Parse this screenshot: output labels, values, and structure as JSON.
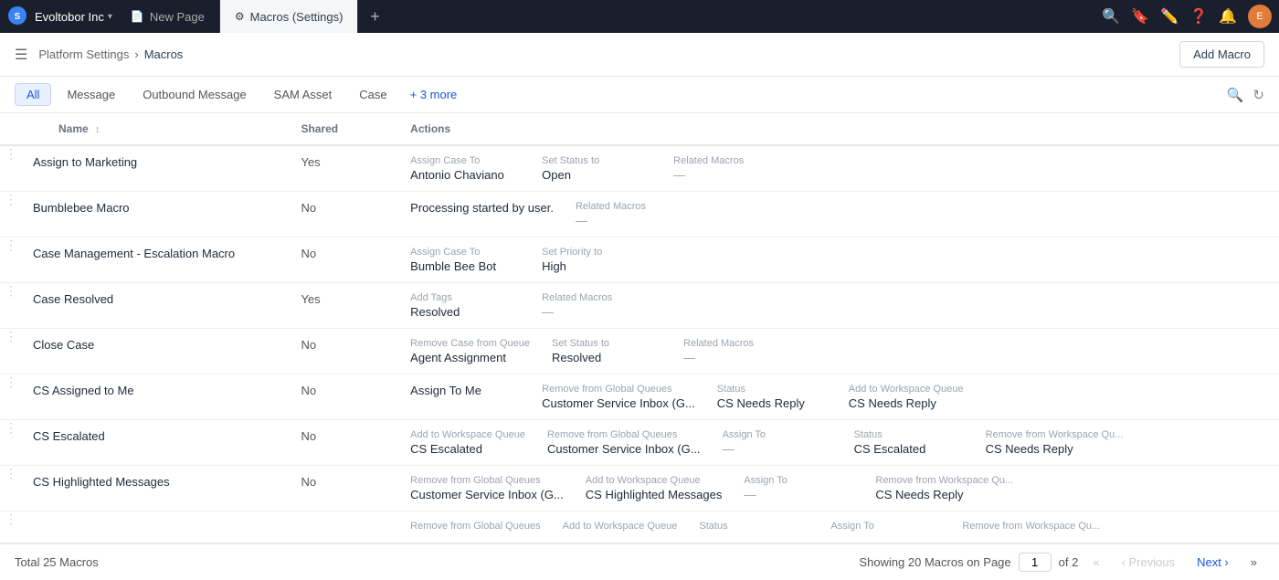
{
  "topNav": {
    "appName": "Evoltobor Inc",
    "chevron": "▾",
    "tabs": [
      {
        "id": "new-page",
        "label": "New Page",
        "icon": "📄",
        "active": false
      },
      {
        "id": "macros-settings",
        "label": "Macros (Settings)",
        "icon": "⚙",
        "active": true
      }
    ],
    "addTabIcon": "+",
    "actions": [
      {
        "id": "search",
        "icon": "🔍"
      },
      {
        "id": "bookmark",
        "icon": "🔖"
      },
      {
        "id": "edit",
        "icon": "✏️"
      },
      {
        "id": "help",
        "icon": "❓"
      },
      {
        "id": "bell",
        "icon": "🔔"
      }
    ],
    "avatar": "E"
  },
  "subHeader": {
    "platformSettings": "Platform Settings",
    "separator": "›",
    "current": "Macros",
    "addMacroLabel": "Add Macro"
  },
  "filterBar": {
    "tabs": [
      {
        "id": "all",
        "label": "All",
        "active": true
      },
      {
        "id": "message",
        "label": "Message",
        "active": false
      },
      {
        "id": "outbound-message",
        "label": "Outbound Message",
        "active": false
      },
      {
        "id": "sam-asset",
        "label": "SAM Asset",
        "active": false
      },
      {
        "id": "case",
        "label": "Case",
        "active": false
      }
    ],
    "moreLabel": "+ 3 more"
  },
  "table": {
    "headers": [
      {
        "id": "name",
        "label": "Name"
      },
      {
        "id": "shared",
        "label": "Shared"
      },
      {
        "id": "actions",
        "label": "Actions"
      }
    ],
    "rows": [
      {
        "id": "assign-to-marketing",
        "name": "Assign to Marketing",
        "shared": "Yes",
        "actions": [
          {
            "label": "Assign Case To",
            "value": "Antonio Chaviano"
          },
          {
            "label": "Set Status to",
            "value": "Open"
          },
          {
            "label": "Related Macros",
            "value": "—"
          }
        ]
      },
      {
        "id": "bumblebee-macro",
        "name": "Bumblebee Macro",
        "shared": "No",
        "actions": [
          {
            "label": "",
            "value": "Processing started by user."
          },
          {
            "label": "Related Macros",
            "value": "—"
          }
        ]
      },
      {
        "id": "case-management-escalation",
        "name": "Case Management - Escalation Macro",
        "shared": "No",
        "actions": [
          {
            "label": "Assign Case To",
            "value": "Bumble Bee Bot"
          },
          {
            "label": "Set Priority to",
            "value": "High"
          }
        ]
      },
      {
        "id": "case-resolved",
        "name": "Case Resolved",
        "shared": "Yes",
        "actions": [
          {
            "label": "Add Tags",
            "value": "Resolved"
          },
          {
            "label": "Related Macros",
            "value": "—"
          }
        ]
      },
      {
        "id": "close-case",
        "name": "Close Case",
        "shared": "No",
        "actions": [
          {
            "label": "Remove Case from Queue",
            "value": "Agent Assignment"
          },
          {
            "label": "Set Status to",
            "value": "Resolved"
          },
          {
            "label": "Related Macros",
            "value": "—"
          }
        ]
      },
      {
        "id": "cs-assigned-to-me",
        "name": "CS Assigned to Me",
        "shared": "No",
        "actions": [
          {
            "label": "",
            "value": "Assign To Me"
          },
          {
            "label": "Remove from Global Queues",
            "value": "Customer Service Inbox (G..."
          },
          {
            "label": "Status",
            "value": "CS Needs Reply"
          },
          {
            "label": "Add to Workspace Queue",
            "value": "CS Needs Reply"
          }
        ]
      },
      {
        "id": "cs-escalated",
        "name": "CS Escalated",
        "shared": "No",
        "actions": [
          {
            "label": "Add to Workspace Queue",
            "value": "CS Escalated"
          },
          {
            "label": "Remove from Global Queues",
            "value": "Customer Service Inbox (G..."
          },
          {
            "label": "Assign To",
            "value": "—"
          },
          {
            "label": "Status",
            "value": "CS Escalated"
          },
          {
            "label": "Remove from Workspace Qu...",
            "value": "CS Needs Reply"
          }
        ]
      },
      {
        "id": "cs-highlighted-messages",
        "name": "CS Highlighted Messages",
        "shared": "No",
        "actions": [
          {
            "label": "Remove from Global Queues",
            "value": "Customer Service Inbox (G..."
          },
          {
            "label": "Add to Workspace Queue",
            "value": "CS Highlighted Messages"
          },
          {
            "label": "Assign To",
            "value": "—"
          },
          {
            "label": "Remove from Workspace Qu...",
            "value": "CS Needs Reply"
          }
        ]
      },
      {
        "id": "row-partial",
        "name": "",
        "shared": "",
        "actions": [
          {
            "label": "Remove from Global Queues",
            "value": ""
          },
          {
            "label": "Add to Workspace Queue",
            "value": ""
          },
          {
            "label": "Status",
            "value": ""
          },
          {
            "label": "Assign To",
            "value": ""
          },
          {
            "label": "Remove from Workspace Qu...",
            "value": ""
          }
        ]
      }
    ]
  },
  "footer": {
    "totalLabel": "Total 25 Macros",
    "showingLabel": "Showing 20 Macros on Page",
    "currentPage": "1",
    "ofLabel": "of 2",
    "firstIcon": "«",
    "prevLabel": "‹ Previous",
    "nextLabel": "Next ›",
    "lastIcon": "»"
  }
}
